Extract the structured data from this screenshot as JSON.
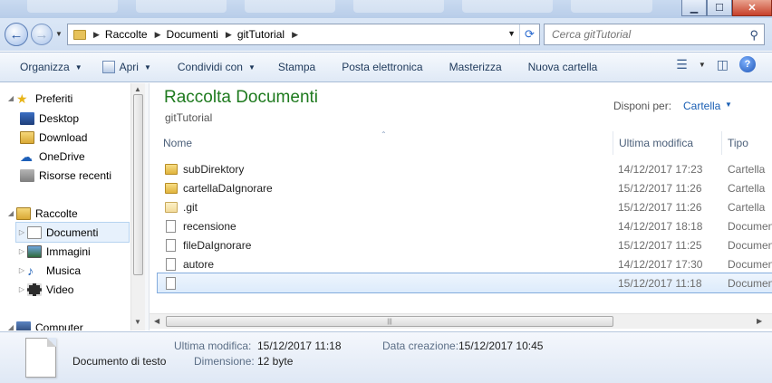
{
  "window": {
    "controls": {
      "minimize": "▁",
      "maximize": "☐",
      "close": "✕"
    }
  },
  "address_bar": {
    "back_icon": "back-arrow-icon",
    "forward_icon": "forward-arrow-icon",
    "breadcrumbs": [
      "Raccolte",
      "Documenti",
      "gitTutorial"
    ],
    "search_placeholder": "Cerca gitTutorial"
  },
  "commands": [
    {
      "label": "Organizza",
      "has_dropdown": true
    },
    {
      "label": "Apri",
      "has_dropdown": true,
      "icon": "open-icon"
    },
    {
      "label": "Condividi con",
      "has_dropdown": true
    },
    {
      "label": "Stampa",
      "has_dropdown": false
    },
    {
      "label": "Posta elettronica",
      "has_dropdown": false
    },
    {
      "label": "Masterizza",
      "has_dropdown": false
    },
    {
      "label": "Nuova cartella",
      "has_dropdown": false
    }
  ],
  "nav_pane": {
    "items": [
      {
        "label": "Preferiti",
        "icon": "star-icon",
        "level": 0
      },
      {
        "label": "Desktop",
        "icon": "desktop-icon",
        "level": 1
      },
      {
        "label": "Download",
        "icon": "download-icon",
        "level": 1
      },
      {
        "label": "OneDrive",
        "icon": "onedrive-icon",
        "level": 1
      },
      {
        "label": "Risorse recenti",
        "icon": "recent-icon",
        "level": 1
      },
      {
        "label": "Raccolte",
        "icon": "libraries-icon",
        "level": 0
      },
      {
        "label": "Documenti",
        "icon": "documents-icon",
        "level": 1,
        "selected": true
      },
      {
        "label": "Immagini",
        "icon": "pictures-icon",
        "level": 1
      },
      {
        "label": "Musica",
        "icon": "music-icon",
        "level": 1
      },
      {
        "label": "Video",
        "icon": "video-icon",
        "level": 1
      },
      {
        "label": "Computer",
        "icon": "computer-icon",
        "level": 0
      }
    ]
  },
  "content": {
    "library_title": "Raccolta Documenti",
    "library_subtitle": "gitTutorial",
    "arrange_label": "Disponi per:",
    "arrange_value": "Cartella",
    "columns": {
      "name": "Nome",
      "modified": "Ultima modifica",
      "type": "Tipo"
    },
    "files": [
      {
        "name": "subDirektory",
        "modified": "14/12/2017 17:23",
        "type": "Cartella",
        "icon": "folder"
      },
      {
        "name": "cartellaDaIgnorare",
        "modified": "15/12/2017 11:26",
        "type": "Cartella",
        "icon": "folder"
      },
      {
        "name": ".git",
        "modified": "15/12/2017 11:26",
        "type": "Cartella",
        "icon": "folder-light"
      },
      {
        "name": "recensione",
        "modified": "14/12/2017 18:18",
        "type": "Documento",
        "icon": "file"
      },
      {
        "name": "fileDaIgnorare",
        "modified": "15/12/2017 11:25",
        "type": "Documento",
        "icon": "file"
      },
      {
        "name": "autore",
        "modified": "14/12/2017 17:30",
        "type": "Documento",
        "icon": "file"
      },
      {
        "name": "",
        "modified": "15/12/2017 11:18",
        "type": "Documento",
        "icon": "file",
        "selected": true
      }
    ]
  },
  "details": {
    "file_type": "Documento di testo",
    "modified_label": "Ultima modifica:",
    "modified_value": "15/12/2017 11:18",
    "created_label": "Data creazione:",
    "created_value": "15/12/2017 10:45",
    "size_label": "Dimensione:",
    "size_value": "12 byte"
  },
  "colors": {
    "library_title": "#1e7a1e",
    "link_blue": "#1a5fb4",
    "selection": "#dcebfc"
  }
}
